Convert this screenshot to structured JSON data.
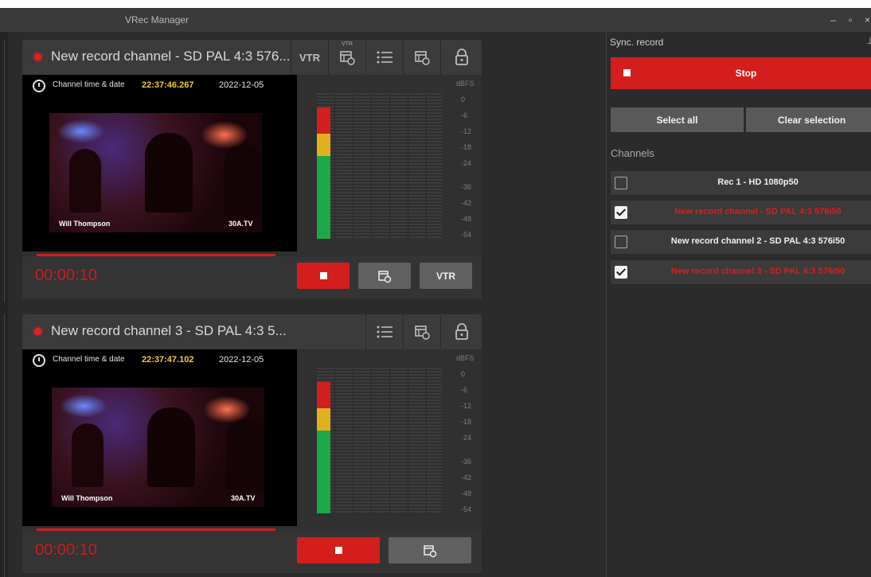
{
  "window": {
    "title": "VRec Manager",
    "controls": [
      "–",
      "▫",
      "×"
    ]
  },
  "colors": {
    "accent_red": "#d41e1e",
    "time_yellow": "#f5c83a",
    "bg_dark": "#2b2b2b",
    "level_green": "#1fa84a",
    "level_yellow": "#e0b020",
    "level_red": "#d02020"
  },
  "channels_view": [
    {
      "title": "New record channel - SD PAL 4:3 576...",
      "toolbar": {
        "vtr_label": "VTR",
        "vtr_small": "VTR",
        "icons": [
          "vtr-schedule-icon",
          "list-icon",
          "schedule-icon",
          "lock-icon"
        ]
      },
      "overlay": {
        "label": "Channel time & date",
        "time": "22:37:46.267",
        "date": "2022-12-05",
        "name_left": "Will Thompson",
        "name_right": "30A.TV"
      },
      "meter": {
        "unit": "dBFS",
        "scale": [
          "0",
          "-6",
          "-12",
          "-18",
          "-24",
          "-36",
          "-42",
          "-48",
          "-54"
        ],
        "level_fraction": 0.9
      },
      "timer": "00:00:10",
      "buttons": {
        "stop_icon": "stop-icon",
        "schedule_icon": "schedule-icon",
        "vtr_label": "VTR"
      }
    },
    {
      "title": "New record channel 3 - SD PAL 4:3 5...",
      "toolbar": {
        "icons": [
          "list-icon",
          "schedule-icon",
          "lock-icon"
        ]
      },
      "overlay": {
        "label": "Channel time & date",
        "time": "22:37:47.102",
        "date": "2022-12-05",
        "name_left": "Will Thompson",
        "name_right": "30A.TV"
      },
      "meter": {
        "unit": "dBFS",
        "scale": [
          "0",
          "-6",
          "-12",
          "-18",
          "-24",
          "-36",
          "-42",
          "-48",
          "-54"
        ],
        "level_fraction": 0.9
      },
      "timer": "00:00:10",
      "buttons": {
        "stop_icon": "stop-icon",
        "schedule_icon": "schedule-icon"
      }
    }
  ],
  "sync": {
    "title": "Sync. record",
    "stop_label": "Stop",
    "select_all": "Select all",
    "clear_selection": "Clear selection",
    "channels_label": "Channels",
    "channels": [
      {
        "name": "Rec 1 - HD 1080p50",
        "checked": false
      },
      {
        "name": "New record channel - SD PAL 4:3 576i50",
        "checked": true
      },
      {
        "name": "New record channel 2 - SD PAL 4:3 576i50",
        "checked": false
      },
      {
        "name": "New record channel 3 - SD PAL 4:3 576i50",
        "checked": true
      }
    ]
  }
}
